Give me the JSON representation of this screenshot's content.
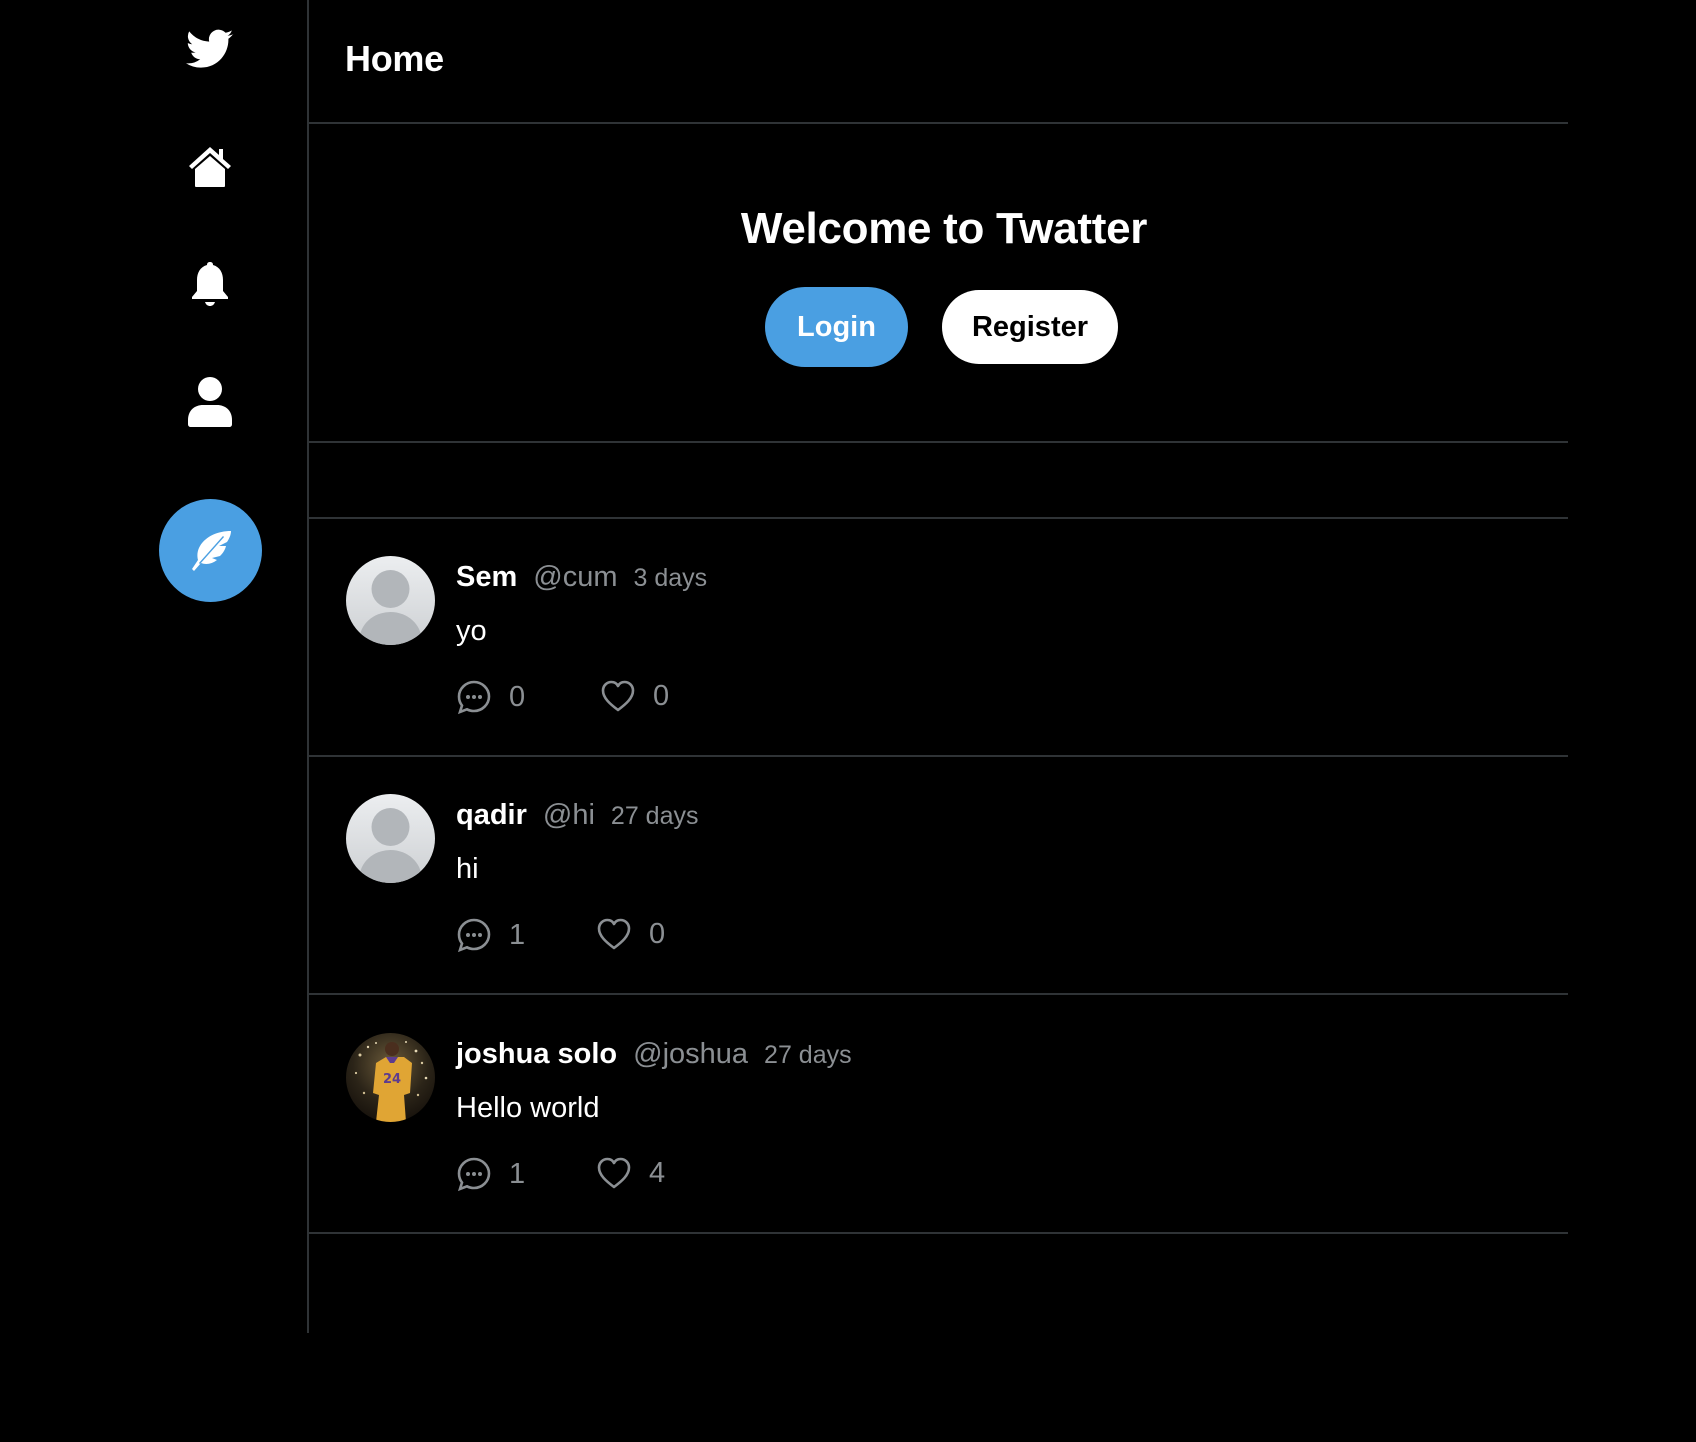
{
  "header": {
    "title": "Home"
  },
  "welcome": {
    "title": "Welcome to Twatter",
    "login_label": "Login",
    "register_label": "Register"
  },
  "colors": {
    "accent": "#4a9fe2",
    "background": "#000000",
    "divider": "#2f3336",
    "muted_text": "#8b8f93"
  },
  "sidebar": {
    "items": [
      {
        "icon": "twitter-bird-icon"
      },
      {
        "icon": "home-icon"
      },
      {
        "icon": "bell-icon"
      },
      {
        "icon": "user-icon"
      },
      {
        "icon": "feather-icon"
      }
    ]
  },
  "tweets": [
    {
      "name": "Sem",
      "handle": "@cum",
      "time": "3 days",
      "body": "yo",
      "comments": "0",
      "likes": "0",
      "avatar": "default-avatar"
    },
    {
      "name": "qadir",
      "handle": "@hi",
      "time": "27 days",
      "body": "hi",
      "comments": "1",
      "likes": "0",
      "avatar": "default-avatar"
    },
    {
      "name": "joshua solo",
      "handle": "@joshua",
      "time": "27 days",
      "body": "Hello world",
      "comments": "1",
      "likes": "4",
      "avatar": "photo-avatar"
    }
  ]
}
